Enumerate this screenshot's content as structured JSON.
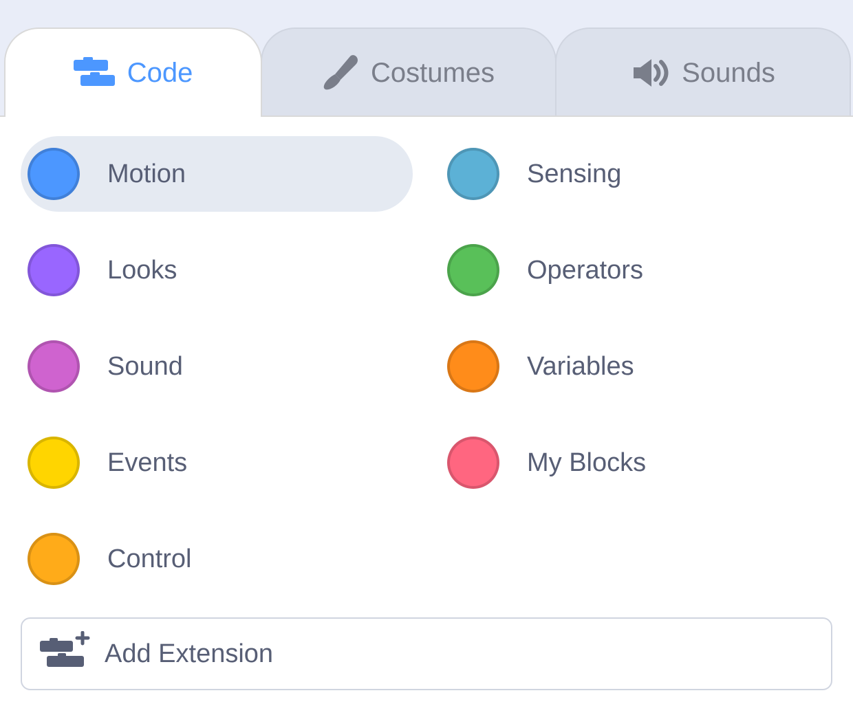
{
  "tabs": {
    "code": "Code",
    "costumes": "Costumes",
    "sounds": "Sounds",
    "active": "code"
  },
  "categories": {
    "left": [
      {
        "label": "Motion",
        "color": "#4C97FF",
        "selected": true
      },
      {
        "label": "Looks",
        "color": "#9966FF",
        "selected": false
      },
      {
        "label": "Sound",
        "color": "#CF63CF",
        "selected": false
      },
      {
        "label": "Events",
        "color": "#FFD500",
        "selected": false
      },
      {
        "label": "Control",
        "color": "#FFAB19",
        "selected": false
      }
    ],
    "right": [
      {
        "label": "Sensing",
        "color": "#5CB1D6",
        "selected": false
      },
      {
        "label": "Operators",
        "color": "#59C059",
        "selected": false
      },
      {
        "label": "Variables",
        "color": "#FF8C1A",
        "selected": false
      },
      {
        "label": "My Blocks",
        "color": "#FF6680",
        "selected": false
      }
    ]
  },
  "addExtension": {
    "label": "Add Extension"
  }
}
